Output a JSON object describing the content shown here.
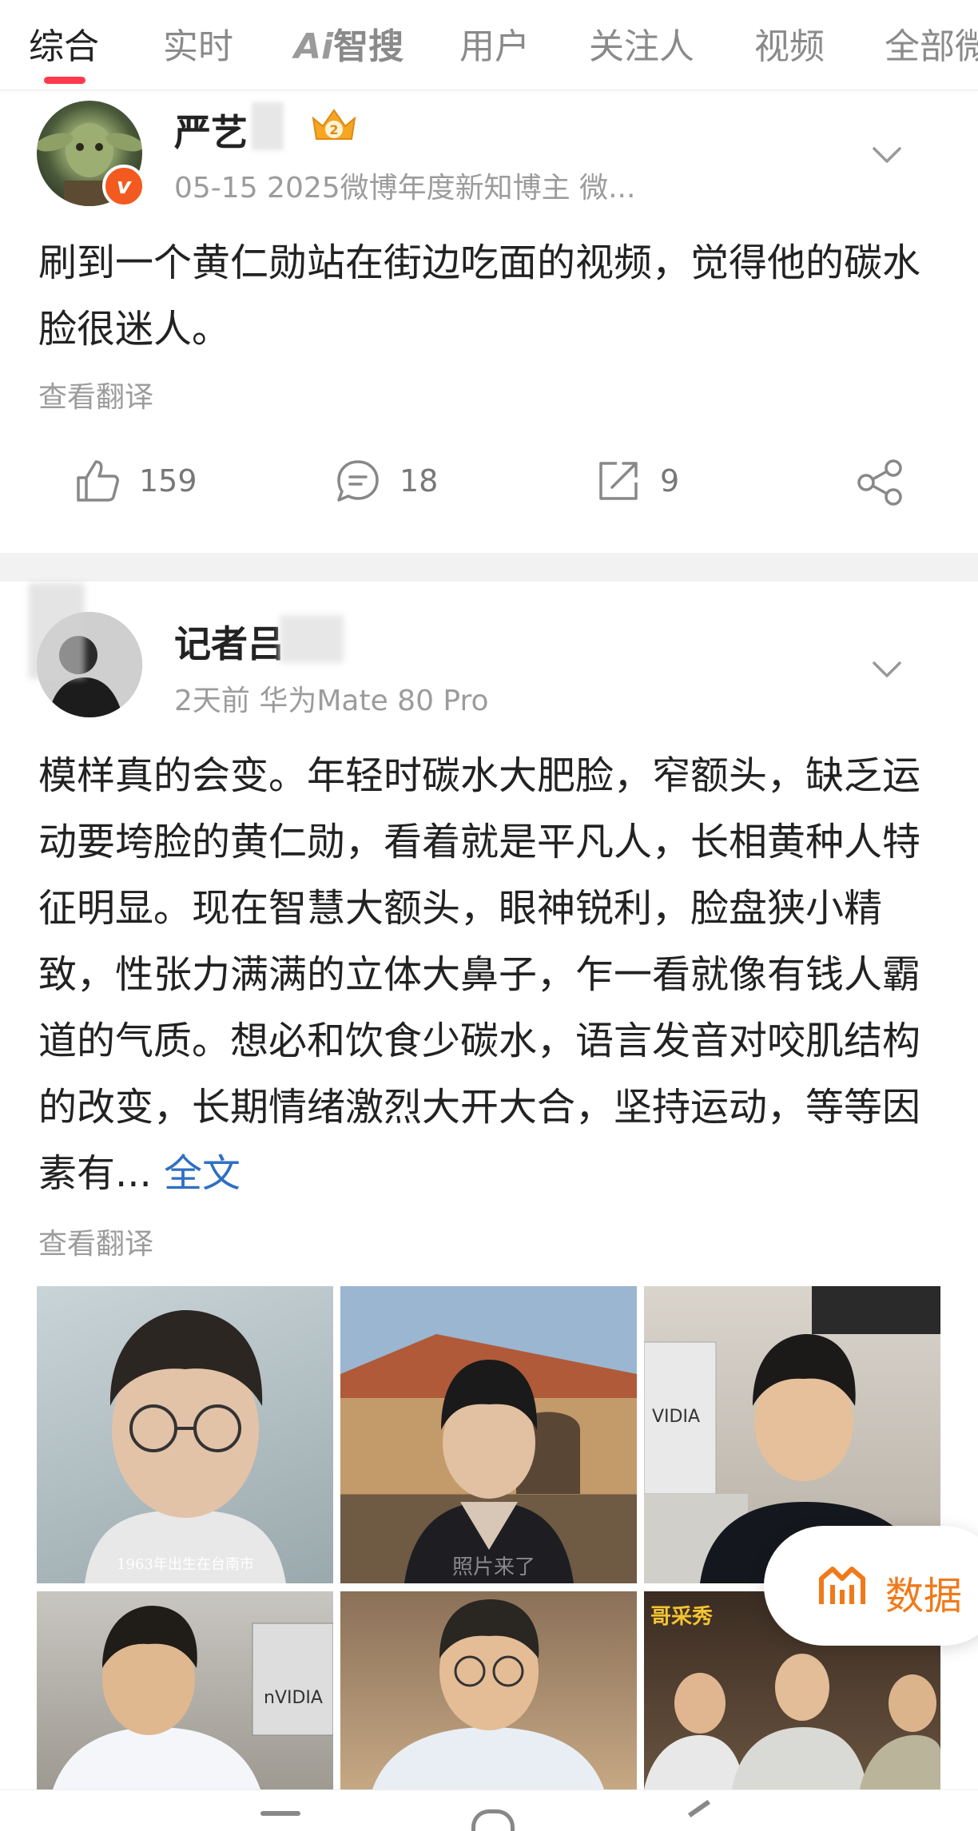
{
  "tabs": [
    {
      "label": "综合",
      "active": true
    },
    {
      "label": "实时"
    },
    {
      "label": "智搜",
      "prefix": "Ai"
    },
    {
      "label": "用户"
    },
    {
      "label": "关注人"
    },
    {
      "label": "视频"
    },
    {
      "label": "全部微"
    }
  ],
  "posts": [
    {
      "user": "严艺",
      "badge_level": "2",
      "verified": "v",
      "meta": "05-15   2025微博年度新知博主 微...",
      "content": "刷到一个黄仁勋站在街边吃面的视频，觉得他的碳水脸很迷人。",
      "translate": "查看翻译",
      "likes": "159",
      "comments": "18",
      "reposts": "9"
    },
    {
      "user": "记者吕",
      "meta": "2天前   华为Mate 80 Pro",
      "content": "模样真的会变。年轻时碳水大肥脸，窄额头，缺乏运动要垮脸的黄仁勋，看着就是平凡人，长相黄种人特征明显。现在智慧大额头，眼神锐利，脸盘狭小精致，性张力满满的立体大鼻子，乍一看就像有钱人霸道的气质。想必和饮食少碳水，语言发音对咬肌结构的改变，长期情绪激烈大开大合，坚持运动，等等因素有...",
      "fulltext": "全文",
      "translate": "查看翻译",
      "photo_captions": [
        "1963年出生在台南市",
        "照片来了",
        "VIDIA",
        "nVIDIA",
        "",
        "哥采秀"
      ]
    }
  ],
  "float_button": {
    "label": "数据",
    "icon": "chart-icon"
  },
  "colors": {
    "accent": "#ff3a4c",
    "link": "#2f6fc4",
    "orange": "#f07a1a"
  }
}
